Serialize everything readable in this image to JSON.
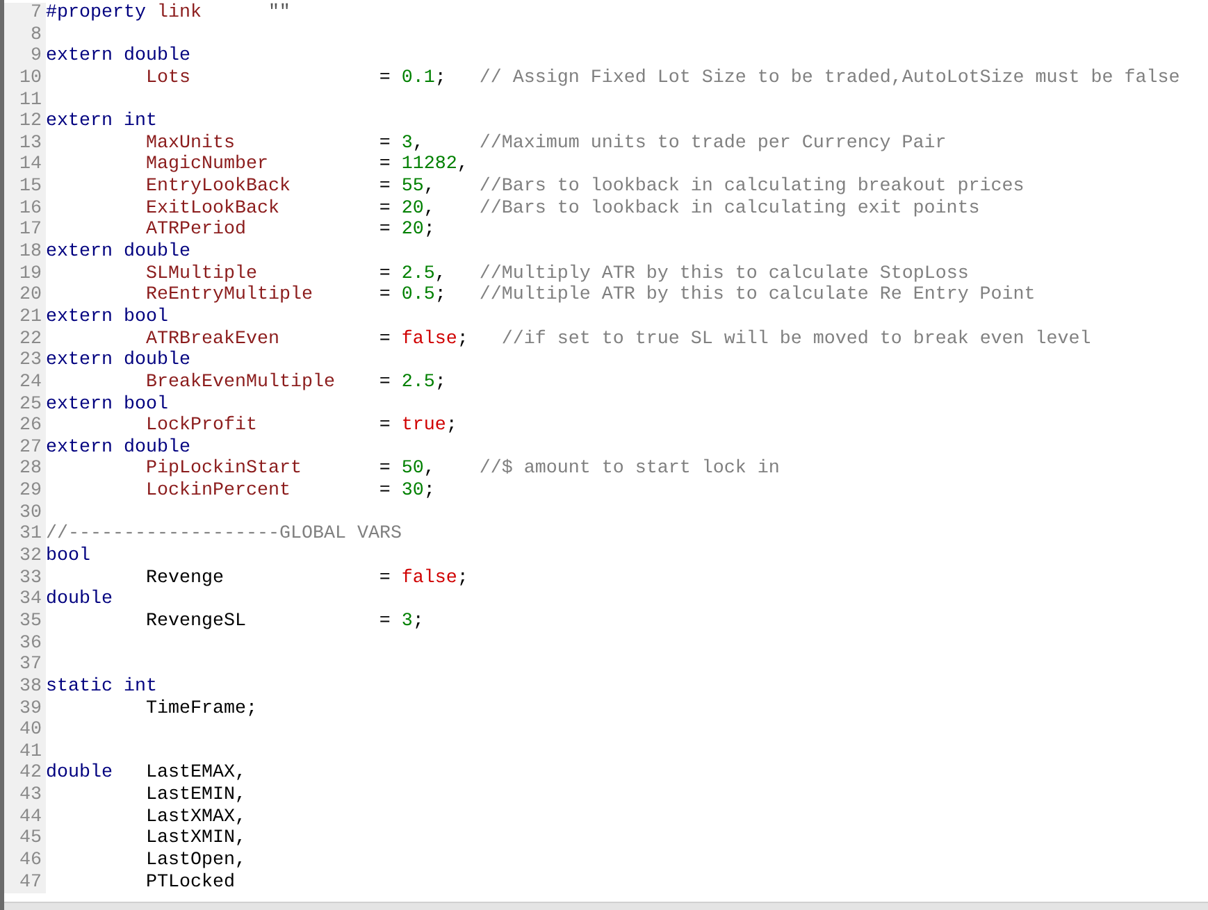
{
  "editor": {
    "lines": [
      {
        "number": "7",
        "kind": "directive",
        "directive": "#property",
        "name": "link",
        "string": "\"\""
      },
      {
        "number": "8",
        "kind": "blank"
      },
      {
        "number": "9",
        "kind": "type",
        "keywords": "extern double"
      },
      {
        "number": "10",
        "kind": "decl",
        "name": "Lots",
        "input": true,
        "op": "=",
        "value": {
          "kind": "number",
          "text": "0.1"
        },
        "end": ";",
        "comment": "// Assign Fixed Lot Size to be traded,AutoLotSize must be false"
      },
      {
        "number": "11",
        "kind": "blank"
      },
      {
        "number": "12",
        "kind": "type",
        "keywords": "extern int"
      },
      {
        "number": "13",
        "kind": "decl",
        "name": "MaxUnits",
        "input": true,
        "op": "=",
        "value": {
          "kind": "number",
          "text": "3"
        },
        "end": ",",
        "comment": "//Maximum units to trade per Currency Pair"
      },
      {
        "number": "14",
        "kind": "decl",
        "name": "MagicNumber",
        "input": true,
        "op": "=",
        "value": {
          "kind": "number",
          "text": "11282"
        },
        "end": ","
      },
      {
        "number": "15",
        "kind": "decl",
        "name": "EntryLookBack",
        "input": true,
        "op": "=",
        "value": {
          "kind": "number",
          "text": "55"
        },
        "end": ",",
        "comment": "//Bars to lookback in calculating breakout prices"
      },
      {
        "number": "16",
        "kind": "decl",
        "name": "ExitLookBack",
        "input": true,
        "op": "=",
        "value": {
          "kind": "number",
          "text": "20"
        },
        "end": ",",
        "comment": "//Bars to lookback in calculating exit points"
      },
      {
        "number": "17",
        "kind": "decl",
        "name": "ATRPeriod",
        "input": true,
        "op": "=",
        "value": {
          "kind": "number",
          "text": "20"
        },
        "end": ";"
      },
      {
        "number": "18",
        "kind": "type",
        "keywords": "extern double"
      },
      {
        "number": "19",
        "kind": "decl",
        "name": "SLMultiple",
        "input": true,
        "op": "=",
        "value": {
          "kind": "number",
          "text": "2.5"
        },
        "end": ",",
        "comment": "//Multiply ATR by this to calculate StopLoss"
      },
      {
        "number": "20",
        "kind": "decl",
        "name": "ReEntryMultiple",
        "input": true,
        "op": "=",
        "value": {
          "kind": "number",
          "text": "0.5"
        },
        "end": ";",
        "comment": "//Multiple ATR by this to calculate Re Entry Point"
      },
      {
        "number": "21",
        "kind": "type",
        "keywords": "extern bool"
      },
      {
        "number": "22",
        "kind": "decl",
        "name": "ATRBreakEven",
        "input": true,
        "op": "=",
        "value": {
          "kind": "bool",
          "text": "false"
        },
        "end": ";",
        "comment": "//if set to true SL will be moved to break even level"
      },
      {
        "number": "23",
        "kind": "type",
        "keywords": "extern double"
      },
      {
        "number": "24",
        "kind": "decl",
        "name": "BreakEvenMultiple",
        "input": true,
        "op": "=",
        "value": {
          "kind": "number",
          "text": "2.5"
        },
        "end": ";"
      },
      {
        "number": "25",
        "kind": "type",
        "keywords": "extern bool"
      },
      {
        "number": "26",
        "kind": "decl",
        "name": "LockProfit",
        "input": true,
        "op": "=",
        "value": {
          "kind": "bool",
          "text": "true"
        },
        "end": ";"
      },
      {
        "number": "27",
        "kind": "type",
        "keywords": "extern double"
      },
      {
        "number": "28",
        "kind": "decl",
        "name": "PipLockinStart",
        "input": true,
        "op": "=",
        "value": {
          "kind": "number",
          "text": "50"
        },
        "end": ",",
        "comment": "//$ amount to start lock in"
      },
      {
        "number": "29",
        "kind": "decl",
        "name": "LockinPercent",
        "input": true,
        "op": "=",
        "value": {
          "kind": "number",
          "text": "30"
        },
        "end": ";"
      },
      {
        "number": "30",
        "kind": "blank"
      },
      {
        "number": "31",
        "kind": "comment",
        "comment": "//-------------------GLOBAL VARS"
      },
      {
        "number": "32",
        "kind": "type",
        "keywords": "bool"
      },
      {
        "number": "33",
        "kind": "decl",
        "name": "Revenge",
        "input": false,
        "op": "=",
        "value": {
          "kind": "bool",
          "text": "false"
        },
        "end": ";"
      },
      {
        "number": "34",
        "kind": "type",
        "keywords": "double"
      },
      {
        "number": "35",
        "kind": "decl",
        "name": "RevengeSL",
        "input": false,
        "op": "=",
        "value": {
          "kind": "number",
          "text": "3"
        },
        "end": ";"
      },
      {
        "number": "36",
        "kind": "blank"
      },
      {
        "number": "37",
        "kind": "blank"
      },
      {
        "number": "38",
        "kind": "type",
        "keywords": "static int"
      },
      {
        "number": "39",
        "kind": "name",
        "name": "TimeFrame;"
      },
      {
        "number": "40",
        "kind": "blank"
      },
      {
        "number": "41",
        "kind": "blank"
      },
      {
        "number": "42",
        "kind": "type",
        "keywords": "double",
        "name": "LastEMAX,"
      },
      {
        "number": "43",
        "kind": "name",
        "name": "LastEMIN,"
      },
      {
        "number": "44",
        "kind": "name",
        "name": "LastXMAX,"
      },
      {
        "number": "45",
        "kind": "name",
        "name": "LastXMIN,"
      },
      {
        "number": "46",
        "kind": "name",
        "name": "LastOpen,"
      },
      {
        "number": "47",
        "kind": "name",
        "name": "PTLocked"
      }
    ]
  }
}
